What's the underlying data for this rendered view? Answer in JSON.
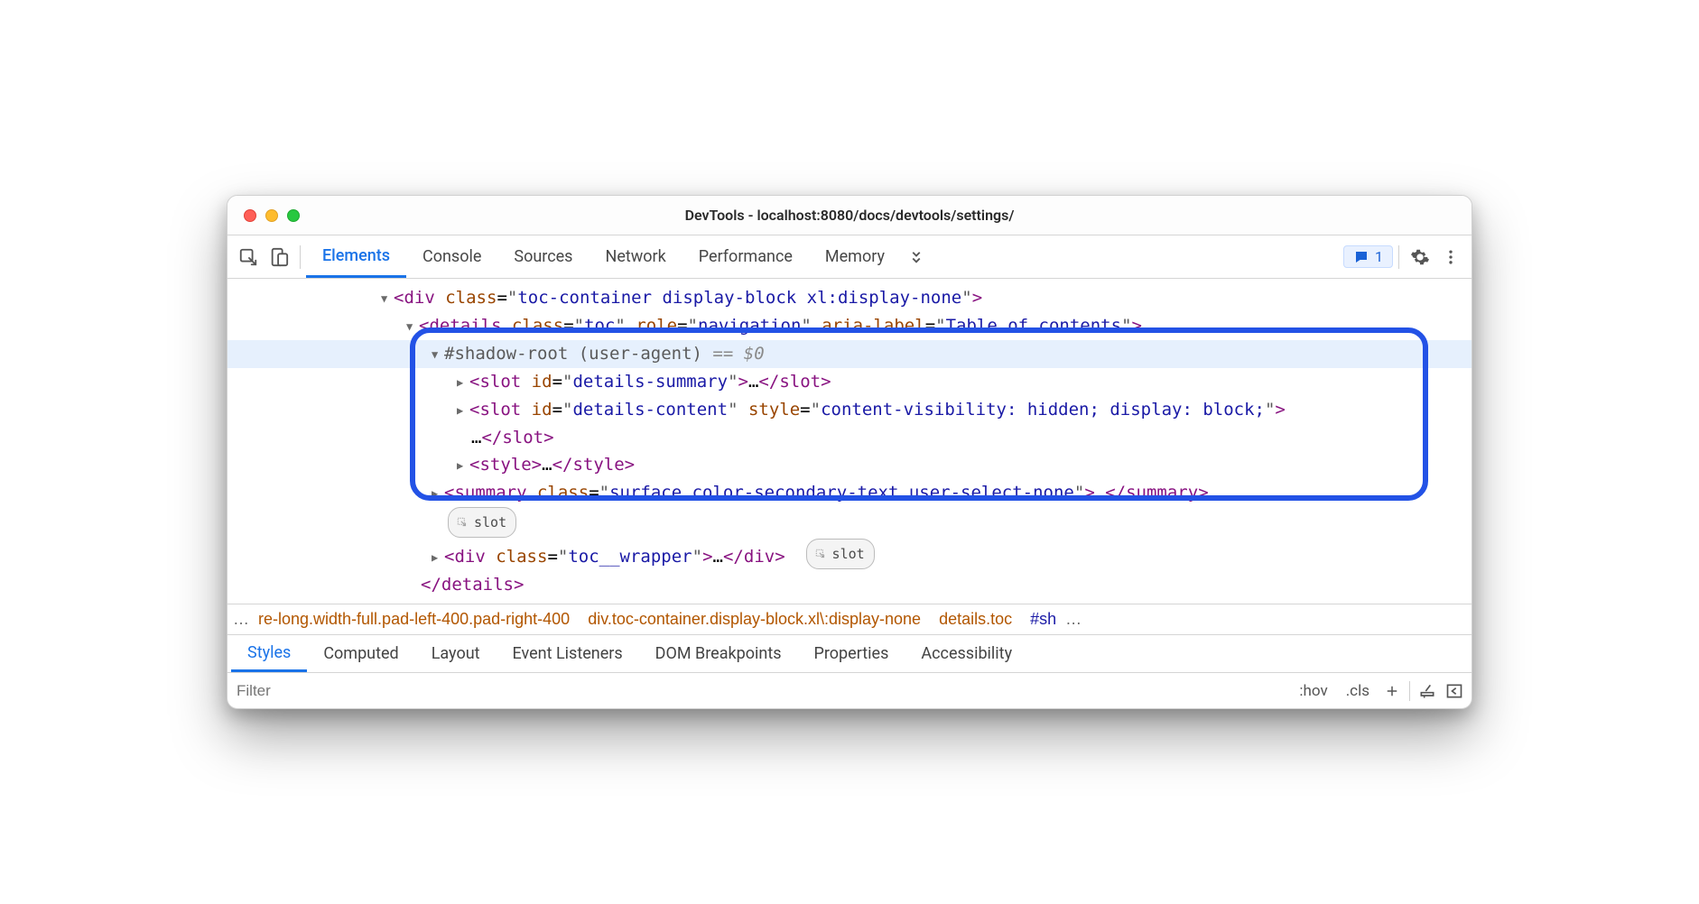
{
  "window": {
    "title": "DevTools - localhost:8080/docs/devtools/settings/"
  },
  "toolbar": {
    "tabs": [
      "Elements",
      "Console",
      "Sources",
      "Network",
      "Performance",
      "Memory"
    ],
    "active_tab": 0,
    "issues_count": "1"
  },
  "dom": {
    "gutter_ellipsis": "⋯",
    "line1": {
      "tag_open": "<",
      "tag": "div",
      "sp": " ",
      "a1": "class",
      "eq": "=",
      "q": "\"",
      "v1": "toc-container display-block xl:display-none",
      "tag_close": ">"
    },
    "line2": {
      "tag_open": "<",
      "tag": "details",
      "sp": " ",
      "a1": "class",
      "eq": "=",
      "q": "\"",
      "v1": "toc",
      "a2": "role",
      "v2": "navigation",
      "a3": "aria-label",
      "v3": "Table of contents",
      "tag_close": ">"
    },
    "line3": {
      "text": "#shadow-root (user-agent)",
      "suffix": " == ",
      "dollar": "$0"
    },
    "line4": {
      "tag_open": "<",
      "tag": "slot",
      "a1": "id",
      "v1": "details-summary",
      "tag_close": ">",
      "ell": "…",
      "close_open": "</",
      "close_tag": "slot",
      "close_end": ">"
    },
    "line5": {
      "tag_open": "<",
      "tag": "slot",
      "a1": "id",
      "v1": "details-content",
      "a2": "style",
      "v2": "content-visibility: hidden; display: block;",
      "tag_close": ">"
    },
    "line5b": {
      "ell": "…",
      "close_open": "</",
      "close_tag": "slot",
      "close_end": ">"
    },
    "line6": {
      "tag_open": "<",
      "tag": "style",
      "tag_close": ">",
      "ell": "…",
      "close_open": "</",
      "close_tag": "style",
      "close_end": ">"
    },
    "line7": {
      "tag_open": "<",
      "tag": "summary",
      "a1": "class",
      "v1": "surface color-secondary-text user-select-none",
      "tag_close": ">",
      "ell": "…",
      "close_open": "</",
      "close_tag": "summary",
      "close_end": ">"
    },
    "slot_badge": "slot",
    "line8": {
      "tag_open": "<",
      "tag": "div",
      "a1": "class",
      "v1": "toc__wrapper",
      "tag_close": ">",
      "ell": "…",
      "close_open": "</",
      "close_tag": "div",
      "close_end": ">"
    },
    "line9": {
      "close_open": "</",
      "close_tag": "details",
      "close_end": ">"
    }
  },
  "breadcrumb": {
    "ell": "…",
    "c1": "re-long.width-full.pad-left-400.pad-right-400",
    "c2": "div.toc-container.display-block.xl\\:display-none",
    "c3": "details.toc",
    "c4": "#sh",
    "ell2": "…"
  },
  "styles_tabs": [
    "Styles",
    "Computed",
    "Layout",
    "Event Listeners",
    "DOM Breakpoints",
    "Properties",
    "Accessibility"
  ],
  "styles_active": 0,
  "filter": {
    "placeholder": "Filter",
    "hov": ":hov",
    "cls": ".cls"
  }
}
